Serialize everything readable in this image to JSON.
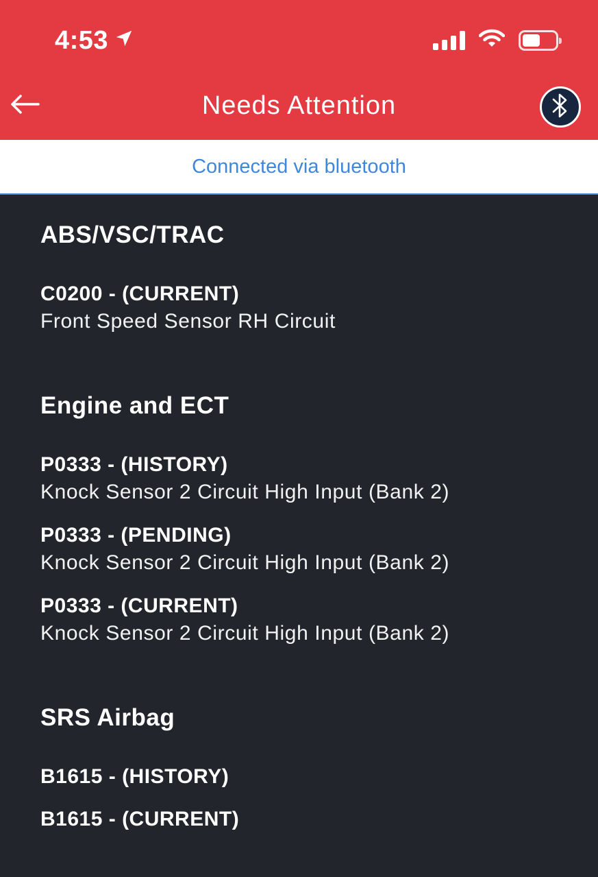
{
  "status_bar": {
    "time": "4:53",
    "icons": [
      "location-arrow-icon",
      "cellular-signal-icon",
      "wifi-icon",
      "battery-icon"
    ],
    "battery_level": 0.55
  },
  "header": {
    "title": "Needs Attention",
    "back_icon": "arrow-left-icon",
    "bluetooth_icon": "bluetooth-icon",
    "background_color": "#e43a41"
  },
  "connection": {
    "text": "Connected via bluetooth",
    "color": "#3f86dd"
  },
  "sections": [
    {
      "title": "ABS/VSC/TRAC",
      "codes": [
        {
          "code": "C0200 - (CURRENT)",
          "description": "Front Speed Sensor RH Circuit"
        }
      ]
    },
    {
      "title": "Engine and ECT",
      "codes": [
        {
          "code": "P0333 - (HISTORY)",
          "description": "Knock Sensor 2 Circuit High Input (Bank 2)"
        },
        {
          "code": "P0333 - (PENDING)",
          "description": "Knock Sensor 2 Circuit High Input (Bank 2)"
        },
        {
          "code": "P0333 - (CURRENT)",
          "description": "Knock Sensor 2 Circuit High Input (Bank 2)"
        }
      ]
    },
    {
      "title": "SRS Airbag",
      "codes": [
        {
          "code": "B1615 - (HISTORY)"
        },
        {
          "code": "B1615 - (CURRENT)"
        }
      ]
    }
  ]
}
